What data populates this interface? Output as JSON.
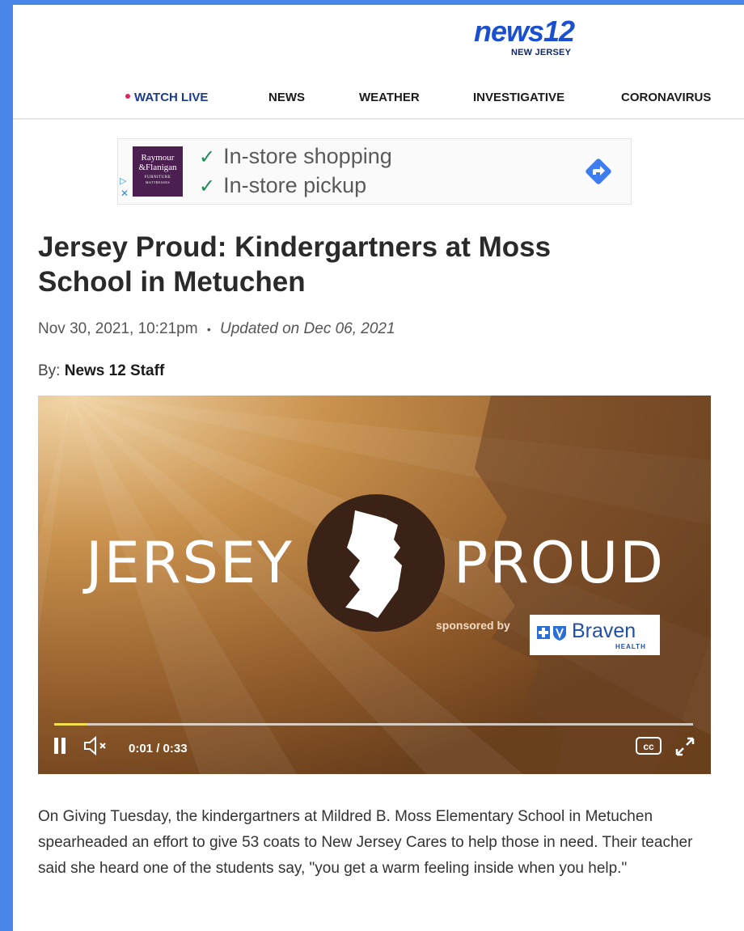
{
  "header": {
    "logo_main": "news12",
    "logo_sub": "NEW JERSEY",
    "nav": [
      {
        "label": "WATCH LIVE"
      },
      {
        "label": "NEWS"
      },
      {
        "label": "WEATHER"
      },
      {
        "label": "INVESTIGATIVE"
      },
      {
        "label": "CORONAVIRUS"
      }
    ]
  },
  "ad": {
    "brand_line1": "Raymour",
    "brand_line2": "&Flanigan",
    "brand_line3": "FURNITURE",
    "brand_line4": "MATTRESSES",
    "lines": [
      "In-store shopping",
      "In-store pickup"
    ],
    "icon_left": "ad-choices-icon",
    "icon_close": "close-icon",
    "icon_right": "directions-icon",
    "accent": "#3d7df0"
  },
  "article": {
    "title": "Jersey Proud: Kindergartners at Moss School in Metuchen",
    "date": "Nov 30, 2021, 10:21pm",
    "separator": "•",
    "updated": "Updated on Dec 06, 2021",
    "byline_prefix": "By:",
    "author": "News 12 Staff",
    "body": "On Giving Tuesday, the kindergartners at Mildred B. Moss Elementary School in Metuchen spearheaded an effort to give 53 coats to New Jersey Cares to help those in need. Their teacher said she heard one of the students say, \"you get a warm feeling inside when you help.\""
  },
  "video": {
    "title_left": "JERSEY",
    "title_right": "PROUD",
    "sponsored_by": "sponsored by",
    "sponsor_name": "Braven",
    "sponsor_sub": "HEALTH",
    "time_display": "0:01 / 0:33",
    "progress_fraction": 0.05,
    "controls": [
      "pause-icon",
      "muted-icon",
      "cc-icon",
      "fullscreen-icon"
    ]
  }
}
